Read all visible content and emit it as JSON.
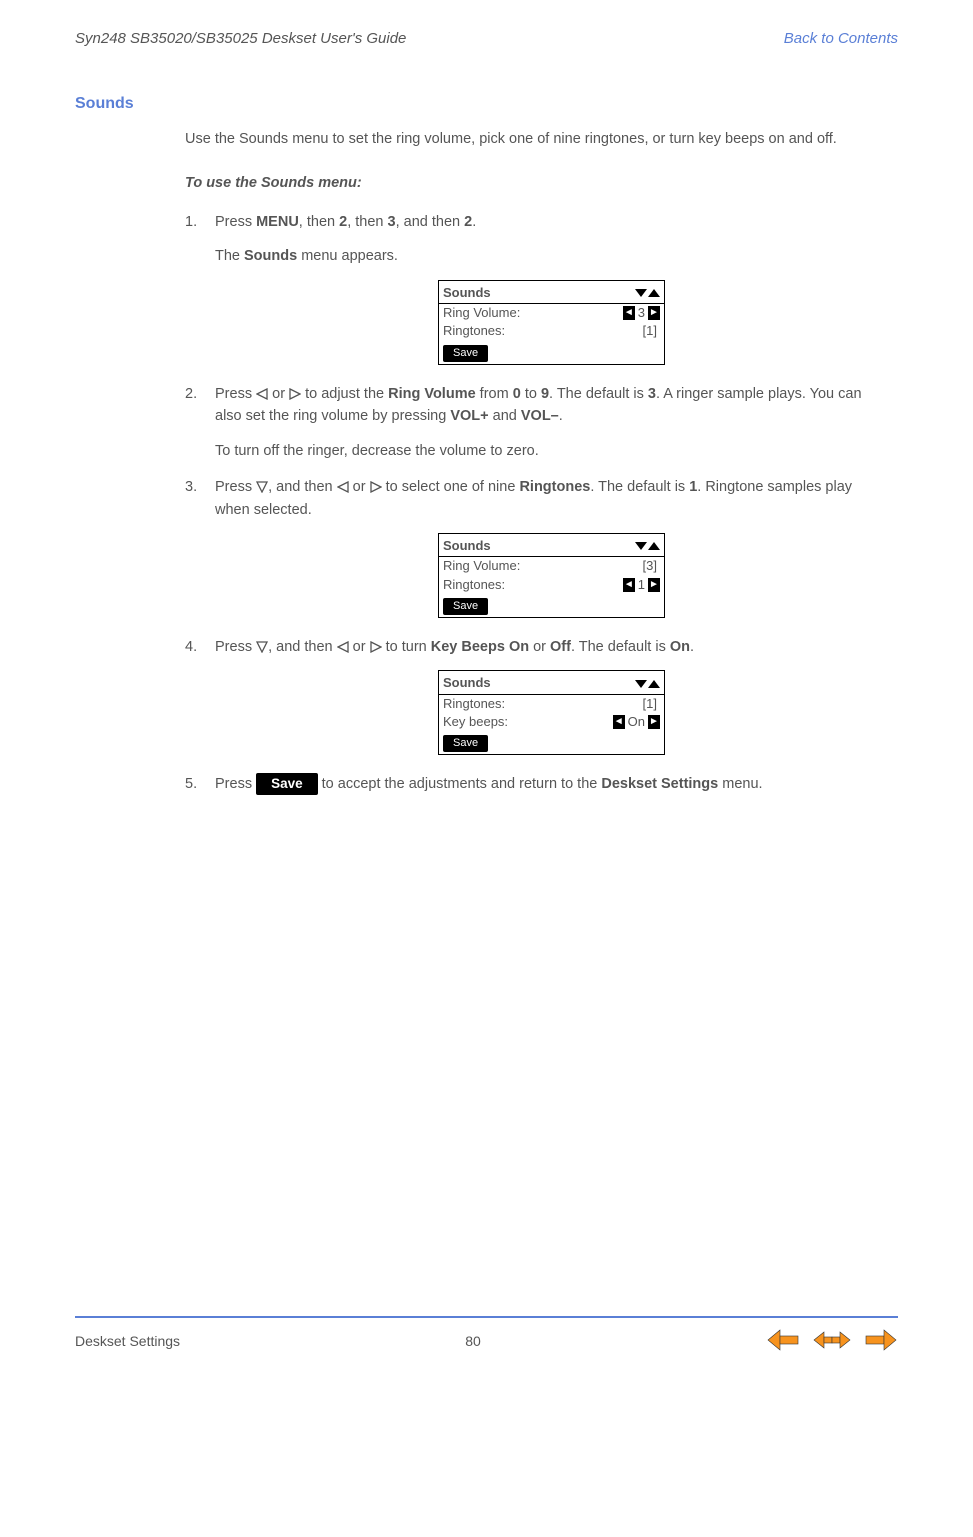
{
  "header": {
    "left": "Syn248 SB35020/SB35025 Deskset User's Guide",
    "right": "Back to Contents"
  },
  "section_title": "Sounds",
  "intro": "Use the Sounds menu to set the ring volume, pick one of nine ringtones, or turn key beeps on and off.",
  "subheading": "To use the Sounds menu:",
  "steps": {
    "s1a": "Press ",
    "s1_menu": "MENU",
    "s1b": ", then ",
    "s1_k2a": "2",
    "s1c": ", then ",
    "s1_k3": "3",
    "s1d": ", and then ",
    "s1_k2b": "2",
    "s1e": ".",
    "s1_sub_a": "The ",
    "s1_sub_bold": "Sounds",
    "s1_sub_b": " menu appears.",
    "s2a": "Press ",
    "s2b": " or ",
    "s2c": " to adjust the ",
    "s2_rv": "Ring Volume",
    "s2d": " from ",
    "s2_0": "0",
    "s2e": " to ",
    "s2_9": "9",
    "s2f": ". The default is ",
    "s2_3": "3",
    "s2g": ". A ringer sample plays. You can also set the ring volume by pressing ",
    "s2_volp": "VOL+",
    "s2h": " and ",
    "s2_volm": "VOL–",
    "s2i": ".",
    "s2_sub": "To turn off the ringer, decrease the volume to zero.",
    "s3a": "Press ",
    "s3b": ", and then ",
    "s3c": " or ",
    "s3d": " to select one of nine ",
    "s3_rt": "Ringtones",
    "s3e": ". The default is ",
    "s3_1": "1",
    "s3f": ". Ringtone samples play when selected.",
    "s4a": "Press ",
    "s4b": ", and then ",
    "s4c": " or ",
    "s4d": " to turn ",
    "s4_kb": "Key Beeps",
    "s4e": " ",
    "s4_on": "On",
    "s4f": " or ",
    "s4_off": "Off",
    "s4g": ". The default is ",
    "s4_on2": "On",
    "s4h": ".",
    "s5a": "Press ",
    "s5_save": "Save",
    "s5b": " to accept the adjustments and return to the ",
    "s5_ds": "Deskset Settings",
    "s5c": " menu."
  },
  "lcd1": {
    "title": "Sounds",
    "row1_label": "Ring Volume:",
    "row1_val": "3",
    "row2_label": "Ringtones:",
    "row2_val": "[1]",
    "save": "Save"
  },
  "lcd2": {
    "title": "Sounds",
    "row1_label": "Ring Volume:",
    "row1_val": "[3]",
    "row2_label": "Ringtones:",
    "row2_val": "1",
    "save": "Save"
  },
  "lcd3": {
    "title": "Sounds",
    "row1_label": "Ringtones:",
    "row1_val": "[1]",
    "row2_label": "Key beeps:",
    "row2_val": "On",
    "save": "Save"
  },
  "footer": {
    "section": "Deskset Settings",
    "page": "80"
  }
}
